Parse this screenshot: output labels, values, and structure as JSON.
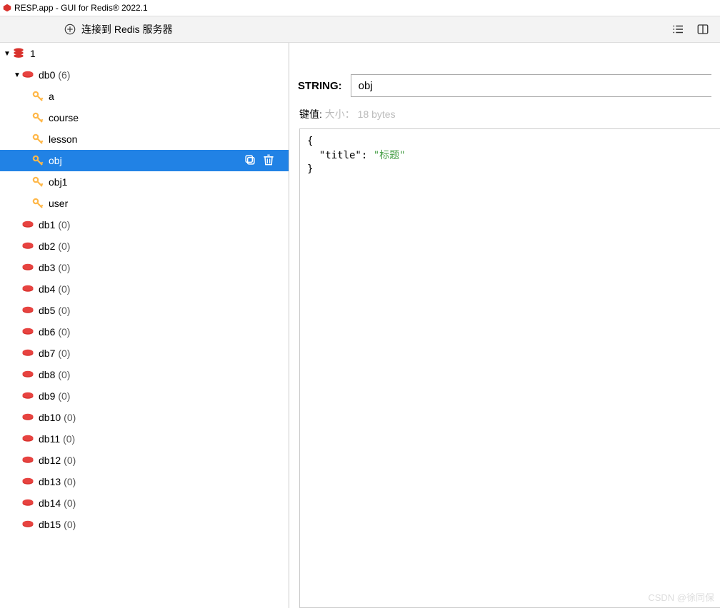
{
  "titlebar": {
    "text": "RESP.app - GUI for Redis® 2022.1"
  },
  "toolbar": {
    "connect_label": "连接到 Redis 服务器"
  },
  "server": {
    "name": "1"
  },
  "databases": [
    {
      "name": "db0",
      "count": "(6)",
      "expanded": true
    },
    {
      "name": "db1",
      "count": "(0)"
    },
    {
      "name": "db2",
      "count": "(0)"
    },
    {
      "name": "db3",
      "count": "(0)"
    },
    {
      "name": "db4",
      "count": "(0)"
    },
    {
      "name": "db5",
      "count": "(0)"
    },
    {
      "name": "db6",
      "count": "(0)"
    },
    {
      "name": "db7",
      "count": "(0)"
    },
    {
      "name": "db8",
      "count": "(0)"
    },
    {
      "name": "db9",
      "count": "(0)"
    },
    {
      "name": "db10",
      "count": "(0)"
    },
    {
      "name": "db11",
      "count": "(0)"
    },
    {
      "name": "db12",
      "count": "(0)"
    },
    {
      "name": "db13",
      "count": "(0)"
    },
    {
      "name": "db14",
      "count": "(0)"
    },
    {
      "name": "db15",
      "count": "(0)"
    }
  ],
  "keys": [
    {
      "name": "a"
    },
    {
      "name": "course"
    },
    {
      "name": "lesson"
    },
    {
      "name": "obj",
      "selected": true
    },
    {
      "name": "obj1"
    },
    {
      "name": "user"
    }
  ],
  "detail": {
    "type_label": "STRING:",
    "key_name": "obj",
    "meta_label": "键值:",
    "meta_size_label": "大小：",
    "meta_size_value": "18 bytes",
    "json": {
      "open": "{",
      "line_key": "  \"title\": ",
      "line_val": "\"标题\"",
      "close": "}"
    }
  },
  "watermark": "CSDN @徐同保"
}
